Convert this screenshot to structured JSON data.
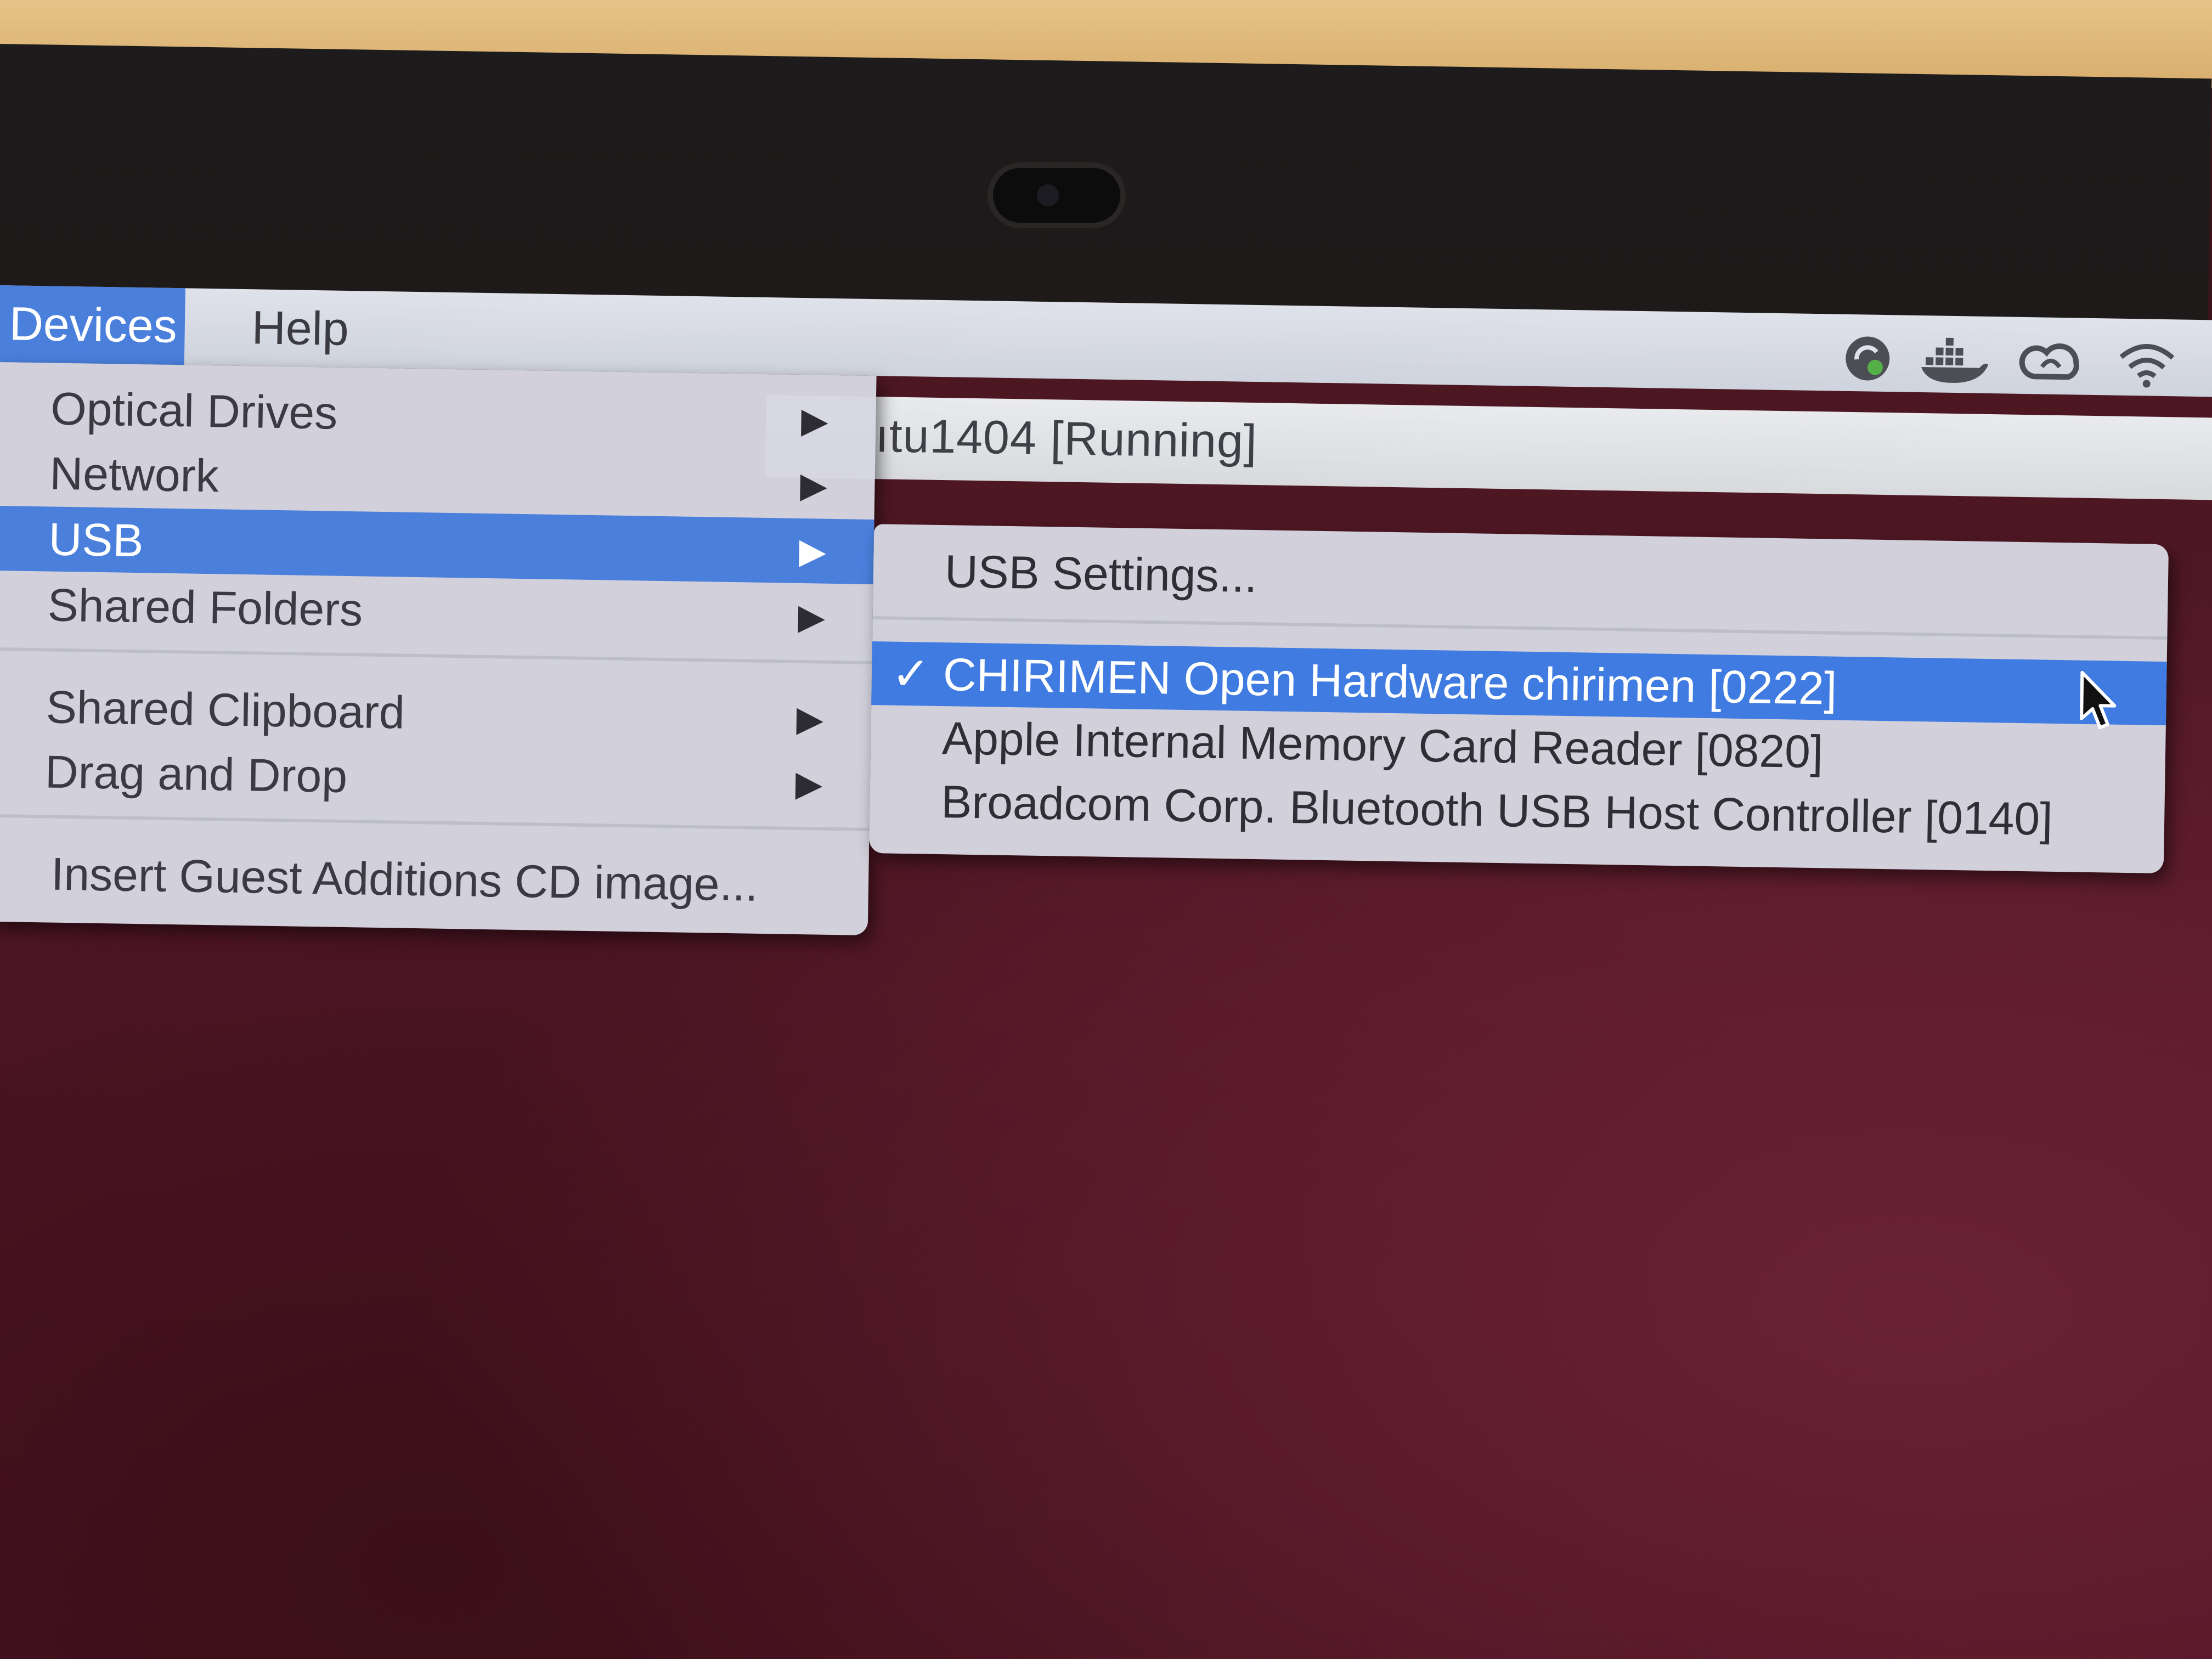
{
  "menubar": {
    "items": [
      {
        "label": "Devices",
        "active": true
      },
      {
        "label": "Help",
        "active": false
      }
    ],
    "status_icons": [
      "sync-icon",
      "docker-icon",
      "creative-cloud-icon",
      "wifi-icon"
    ]
  },
  "vm_window": {
    "title": "ıtu1404 [Running]"
  },
  "devices_menu": {
    "items": [
      {
        "label": "Optical Drives",
        "has_submenu": true
      },
      {
        "label": "Network",
        "has_submenu": true
      },
      {
        "label": "USB",
        "has_submenu": true,
        "highlighted": true
      },
      {
        "label": "Shared Folders",
        "has_submenu": true
      },
      {
        "label": "Shared Clipboard",
        "has_submenu": true
      },
      {
        "label": "Drag and Drop",
        "has_submenu": true
      },
      {
        "label": "Insert Guest Additions CD image...",
        "has_submenu": false
      }
    ],
    "arrow_glyph": "▶"
  },
  "usb_submenu": {
    "settings_label": "USB Settings...",
    "devices": [
      {
        "label": "CHIRIMEN Open Hardware chirimen [0222]",
        "checked": true,
        "highlighted": true
      },
      {
        "label": "Apple Internal Memory Card Reader [0820]",
        "checked": false
      },
      {
        "label": "Broadcom Corp. Bluetooth USB Host Controller [0140]",
        "checked": false
      }
    ],
    "check_glyph": "✓"
  },
  "colors": {
    "highlight": "#4a7fdc",
    "menu_bg": "#d6d7e1",
    "screen_bg": "#4e1623"
  }
}
